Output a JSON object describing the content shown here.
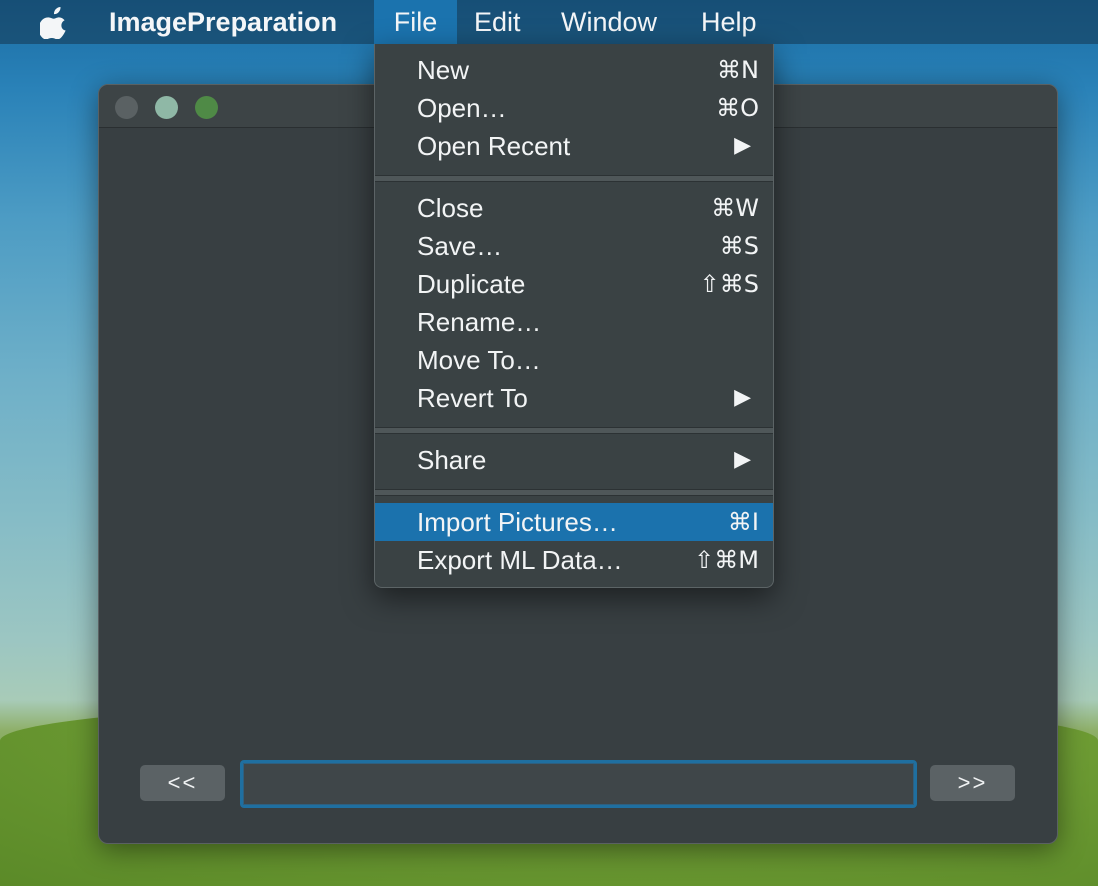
{
  "menubar": {
    "app_name": "ImagePreparation",
    "items": [
      "File",
      "Edit",
      "Window",
      "Help"
    ]
  },
  "file_menu": {
    "items": [
      {
        "label": "New",
        "shortcut": "⌘N"
      },
      {
        "label": "Open…",
        "shortcut": "⌘O"
      },
      {
        "label": "Open Recent",
        "shortcut": "",
        "submenu": "▶"
      },
      {
        "label": "Close",
        "shortcut": "⌘W"
      },
      {
        "label": "Save…",
        "shortcut": "⌘S"
      },
      {
        "label": "Duplicate",
        "shortcut": "⇧⌘S"
      },
      {
        "label": "Rename…",
        "shortcut": ""
      },
      {
        "label": "Move To…",
        "shortcut": ""
      },
      {
        "label": "Revert To",
        "shortcut": "",
        "submenu": "▶"
      },
      {
        "label": "Share",
        "shortcut": "",
        "submenu": "▶"
      },
      {
        "label": "Import Pictures…",
        "shortcut": "⌘I"
      },
      {
        "label": "Export ML Data…",
        "shortcut": "⇧⌘M"
      }
    ]
  },
  "window": {
    "prev_label": "<<",
    "next_label": ">>",
    "path_value": ""
  },
  "colors": {
    "menu_highlight": "#1b73ae",
    "window_bg": "#383f42"
  }
}
